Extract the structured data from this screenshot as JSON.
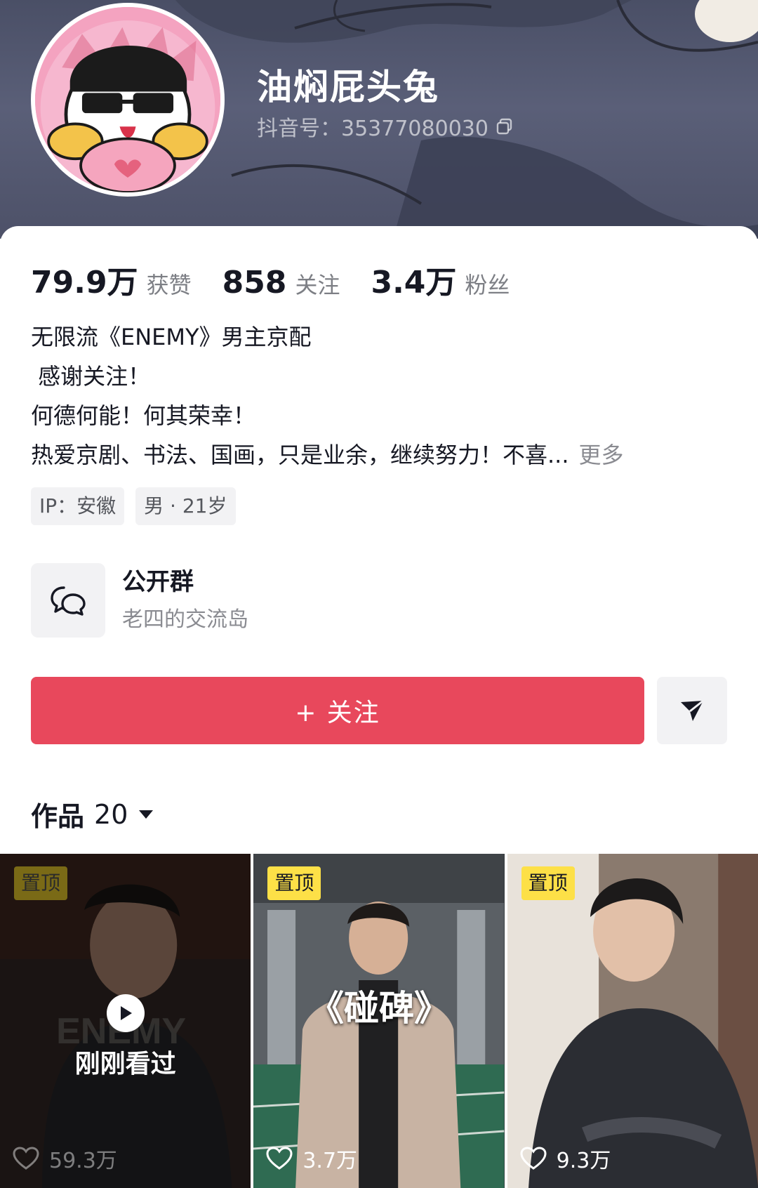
{
  "profile": {
    "nickname": "油焖屁头兔",
    "douyin_id": "抖音号：35377080030"
  },
  "stats": [
    {
      "value": "79.9万",
      "label": "获赞"
    },
    {
      "value": "858",
      "label": "关注"
    },
    {
      "value": "3.4万",
      "label": "粉丝"
    }
  ],
  "bio": {
    "lines": [
      "无限流《ENEMY》男主京配",
      " 感谢关注！",
      "何德何能！何其荣幸！",
      "热爱京剧、书法、国画，只是业余，继续努力！不喜..."
    ],
    "more": "更多"
  },
  "tags": [
    "IP：安徽",
    "男 · 21岁"
  ],
  "group": {
    "title": "公开群",
    "subtitle": "老四的交流岛"
  },
  "actions": {
    "follow_label": "+ 关注"
  },
  "works": {
    "label": "作品",
    "count": "20"
  },
  "videos": [
    {
      "badge": "置顶",
      "likes": "59.3万",
      "overlay": "刚刚看过",
      "watched": true
    },
    {
      "badge": "置顶",
      "likes": "3.7万",
      "title": "《碰碑》",
      "watched": false
    },
    {
      "badge": "置顶",
      "likes": "9.3万",
      "watched": false
    }
  ],
  "colors": {
    "follow_button": "#e8485c",
    "pin_badge": "#fde047",
    "header_bg": "#4d5168"
  },
  "icons": {
    "copy": "copy-icon",
    "group": "chat-bubbles-icon",
    "share": "send-icon",
    "caret": "caret-down-icon",
    "like": "heart-icon",
    "play": "play-icon"
  }
}
